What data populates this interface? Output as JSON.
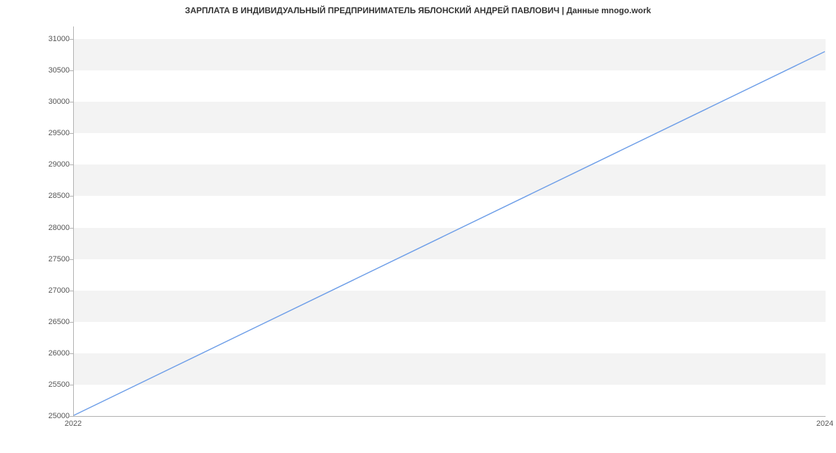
{
  "chart_data": {
    "type": "line",
    "title": "ЗАРПЛАТА В ИНДИВИДУАЛЬНЫЙ ПРЕДПРИНИМАТЕЛЬ ЯБЛОНСКИЙ АНДРЕЙ ПАВЛОВИЧ | Данные mnogo.work",
    "x": [
      2022,
      2024
    ],
    "values": [
      25000,
      30800
    ],
    "x_ticks": [
      2022,
      2024
    ],
    "y_ticks": [
      25000,
      25500,
      26000,
      26500,
      27000,
      27500,
      28000,
      28500,
      29000,
      29500,
      30000,
      30500,
      31000
    ],
    "xlim": [
      2022,
      2024
    ],
    "ylim": [
      25000,
      31200
    ],
    "xlabel": "",
    "ylabel": "",
    "line_color": "#6f9fe8"
  }
}
